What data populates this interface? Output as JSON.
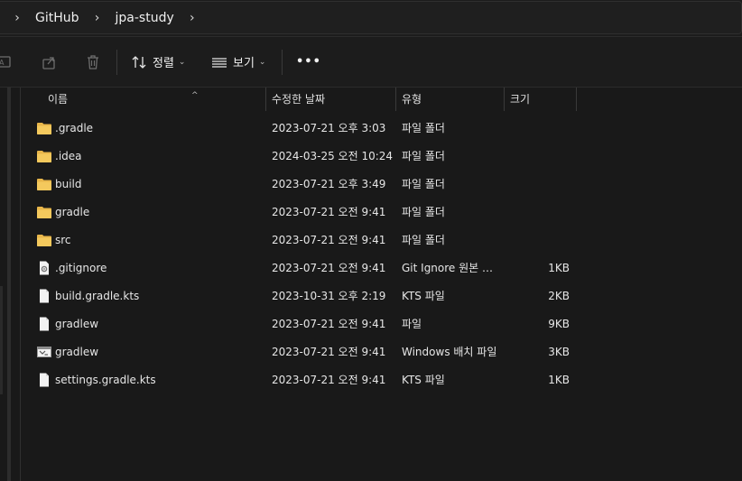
{
  "breadcrumb": {
    "items": [
      "GitHub",
      "jpa-study"
    ]
  },
  "toolbar": {
    "sort_label": "정렬",
    "view_label": "보기",
    "more_label": "•••"
  },
  "columns": {
    "name": "이름",
    "modified": "수정한 날짜",
    "type": "유형",
    "size": "크기"
  },
  "files": [
    {
      "name": ".gradle",
      "modified": "2023-07-21 오후 3:03",
      "type": "파일 폴더",
      "size": "",
      "icon": "folder-icon"
    },
    {
      "name": ".idea",
      "modified": "2024-03-25 오전 10:24",
      "type": "파일 폴더",
      "size": "",
      "icon": "folder-icon"
    },
    {
      "name": "build",
      "modified": "2023-07-21 오후 3:49",
      "type": "파일 폴더",
      "size": "",
      "icon": "folder-icon"
    },
    {
      "name": "gradle",
      "modified": "2023-07-21 오전 9:41",
      "type": "파일 폴더",
      "size": "",
      "icon": "folder-icon"
    },
    {
      "name": "src",
      "modified": "2023-07-21 오전 9:41",
      "type": "파일 폴더",
      "size": "",
      "icon": "folder-icon"
    },
    {
      "name": ".gitignore",
      "modified": "2023-07-21 오전 9:41",
      "type": "Git Ignore 원본 파...",
      "size": "1KB",
      "icon": "settings-file-icon"
    },
    {
      "name": "build.gradle.kts",
      "modified": "2023-10-31 오후 2:19",
      "type": "KTS 파일",
      "size": "2KB",
      "icon": "file-icon"
    },
    {
      "name": "gradlew",
      "modified": "2023-07-21 오전 9:41",
      "type": "파일",
      "size": "9KB",
      "icon": "file-icon"
    },
    {
      "name": "gradlew",
      "modified": "2023-07-21 오전 9:41",
      "type": "Windows 배치 파일",
      "size": "3KB",
      "icon": "batch-file-icon"
    },
    {
      "name": "settings.gradle.kts",
      "modified": "2023-07-21 오전 9:41",
      "type": "KTS 파일",
      "size": "1KB",
      "icon": "file-icon"
    }
  ]
}
